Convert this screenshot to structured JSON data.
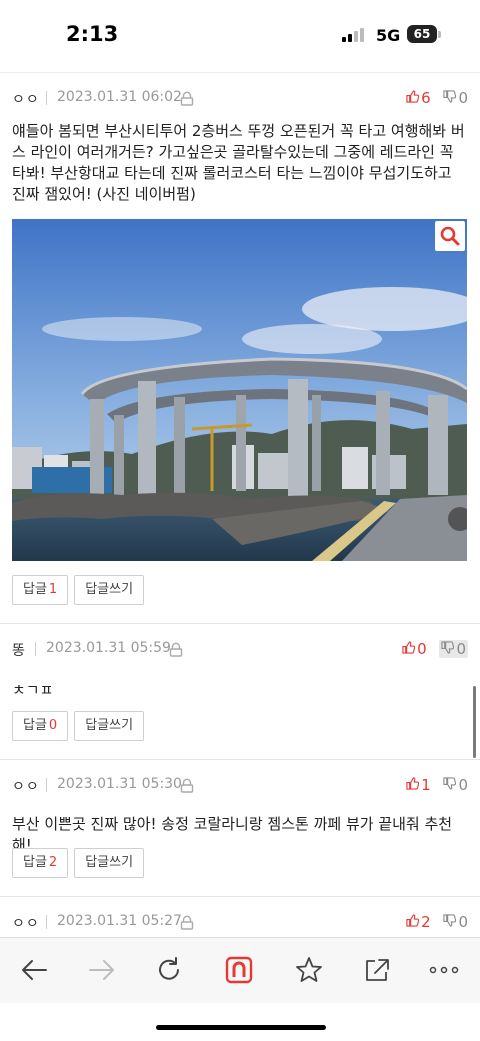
{
  "status": {
    "time": "2:13",
    "network": "5G",
    "battery": "65"
  },
  "labels": {
    "reply": "답글",
    "write_reply": "답글쓰기"
  },
  "comments": [
    {
      "author": "ㅇㅇ",
      "date": "2023.01.31 06:02",
      "likes": "6",
      "dislikes": "0",
      "text": "얘들아 봄되면 부산시티투어 2층버스 뚜껑 오픈된거 꼭 타고 여행해봐 버스 라인이 여러개거든? 가고싶은곳 골라탈수있는데 그중에 레드라인 꼭 타봐! 부산항대교 타는데 진짜 롤러코스터 타는 느낌이야 무섭기도하고 진짜 잼있어! (사진 네이버펌)",
      "reply_count": "1"
    },
    {
      "author": "똥",
      "date": "2023.01.31 05:59",
      "likes": "0",
      "dislikes": "0",
      "text": "ㅊㄱㅍ",
      "reply_count": "0"
    },
    {
      "author": "ㅇㅇ",
      "date": "2023.01.31 05:30",
      "likes": "1",
      "dislikes": "0",
      "text": "부산 이쁜곳 진짜 많아! 송정 코랄라니랑 젬스톤 까페 뷰가 끝내줘 추천해!",
      "reply_count": "2"
    },
    {
      "author": "ㅇㅇ",
      "date": "2023.01.31 05:27",
      "likes": "2",
      "dislikes": "0"
    }
  ],
  "toolbar": {
    "items": [
      "back-icon",
      "forward-icon",
      "reload-icon",
      "naver-n-icon",
      "bookmark-star-icon",
      "share-icon",
      "more-icon"
    ]
  },
  "colors": {
    "accent": "#e53935",
    "naver_red": "#e53935",
    "muted": "#999999"
  }
}
